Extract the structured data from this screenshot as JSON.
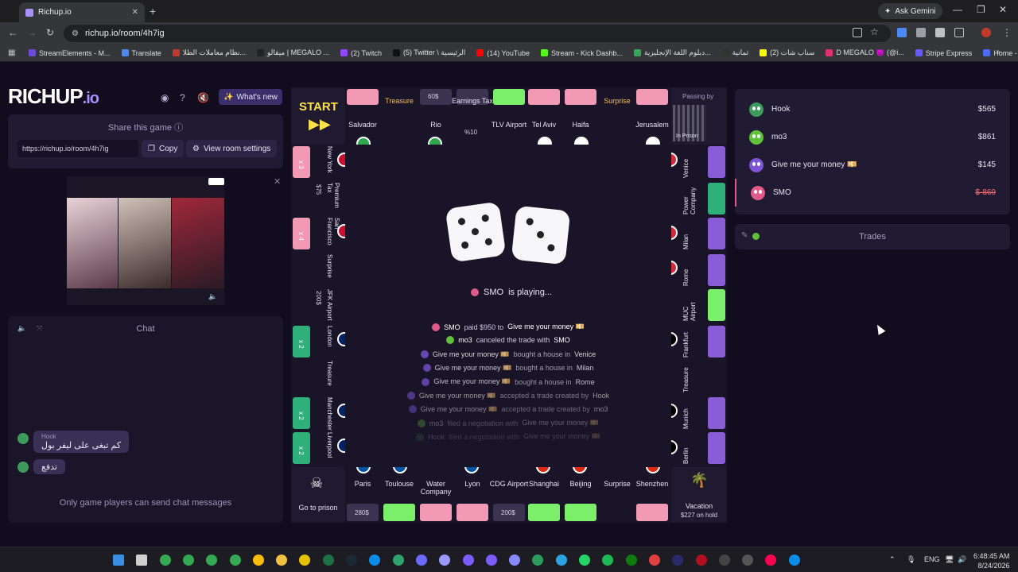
{
  "browser": {
    "tab_title": "Richup.io",
    "ask_gemini": "Ask Gemini",
    "url": "richup.io/room/4h7ig",
    "bookmarks": [
      {
        "label": "StreamElements - M...",
        "color": "#6b4bd8"
      },
      {
        "label": "Translate",
        "color": "#4a8af4"
      },
      {
        "label": "نظام معاملات الطلا...",
        "color": "#c0392b"
      },
      {
        "label": "ميقالو | MEGALO ...",
        "color": "#222222"
      },
      {
        "label": "(2) Twitch",
        "color": "#9146ff"
      },
      {
        "label": "(5) Twitter \\ الرئيسية",
        "color": "#111111"
      },
      {
        "label": "(14) YouTube",
        "color": "#ff0000"
      },
      {
        "label": "Stream - Kick Dashb...",
        "color": "#53fc18"
      },
      {
        "label": "دبلوم اللغة الإنجليزية...",
        "color": "#34a853"
      },
      {
        "label": "ثمانية",
        "color": "#333333"
      },
      {
        "label": "(2) سناب شات",
        "color": "#fffc00"
      },
      {
        "label": "D MEGALO 😈 (@i...",
        "color": "#e1306c"
      },
      {
        "label": "Stripe Express",
        "color": "#635bff"
      },
      {
        "label": "Home - Restream",
        "color": "#4a6cf7"
      }
    ]
  },
  "app": {
    "logo_main": "RICHUP",
    "logo_suffix": ".io",
    "whats_new": "What's new",
    "share": {
      "title": "Share this game",
      "url": "https://richup.io/room/4h7ig",
      "copy": "Copy",
      "settings": "View room settings"
    },
    "chat": {
      "title": "Chat",
      "messages": [
        {
          "author": "Hook",
          "text": "كم تبغى على ليفر بول"
        },
        {
          "author": "",
          "text": "تدفع"
        }
      ],
      "note": "Only game players can send chat messages"
    }
  },
  "board": {
    "corners": {
      "start": "START",
      "in_prison": "In Prison",
      "passing_by": "Passing by",
      "go_to_prison": "Go to prison",
      "vacation": "Vacation",
      "vacation_amount": "$227 on hold"
    },
    "top": [
      {
        "name": "Salvador",
        "strip": "#f29ab5"
      },
      {
        "name": "Treasure",
        "strip": ""
      },
      {
        "name": "Rio",
        "price": "60$"
      },
      {
        "name": "Earnings Tax",
        "sub": "%10"
      },
      {
        "name": "TLV Airport",
        "strip": "#7bef6a"
      },
      {
        "name": "Tel Aviv",
        "strip": "#f29ab5"
      },
      {
        "name": "Haifa",
        "strip": "#f29ab5"
      },
      {
        "name": "Surprise",
        "strip": ""
      },
      {
        "name": "Jerusalem",
        "strip": "#f29ab5"
      }
    ],
    "left": [
      {
        "name": "New York",
        "mult": "x 3"
      },
      {
        "name": "Premium Tax",
        "price": "$75"
      },
      {
        "name": "San Francisco",
        "mult": "x 4"
      },
      {
        "name": "Surprise"
      },
      {
        "name": "JFK Airport",
        "price": "200$"
      },
      {
        "name": "London",
        "mult": "x 2"
      },
      {
        "name": "Treasure"
      },
      {
        "name": "Manchester",
        "mult": "x 2"
      },
      {
        "name": "Liverpool",
        "mult": "x 2"
      }
    ],
    "right": [
      {
        "name": "Venice"
      },
      {
        "name": "Power Company"
      },
      {
        "name": "Milan"
      },
      {
        "name": "Rome"
      },
      {
        "name": "MUC Airport"
      },
      {
        "name": "Frankfurt"
      },
      {
        "name": "Treasure"
      },
      {
        "name": "Munich"
      },
      {
        "name": "Berlin"
      }
    ],
    "bottom": [
      {
        "name": "Paris",
        "price": "280$"
      },
      {
        "name": "Toulouse"
      },
      {
        "name": "Water Company"
      },
      {
        "name": "Lyon"
      },
      {
        "name": "CDG Airport",
        "price": "200$"
      },
      {
        "name": "Shanghai"
      },
      {
        "name": "Beijing"
      },
      {
        "name": "Surprise"
      },
      {
        "name": "Shenzhen"
      }
    ],
    "dice": [
      5,
      3
    ],
    "playing_name": "SMO",
    "playing_suffix": "is playing...",
    "log": [
      {
        "a": "SMO",
        "verb": "paid $950 to",
        "b": "Give me your money 💴",
        "opacity": "1"
      },
      {
        "a": "mo3",
        "verb": "canceled the trade with",
        "b": "SMO",
        "opacity": "1"
      },
      {
        "a": "Give me your money 💴",
        "verb": "bought a house in",
        "b": "Venice",
        "opacity": "0.8"
      },
      {
        "a": "Give me your money 💴",
        "verb": "bought a house in",
        "b": "Milan",
        "opacity": "0.75"
      },
      {
        "a": "Give me your money 💴",
        "verb": "bought a house in",
        "b": "Rome",
        "opacity": "0.7"
      },
      {
        "a": "Give me your money 💴",
        "verb": "accepted a trade created by",
        "b": "Hook",
        "opacity": "0.55"
      },
      {
        "a": "Give me your money 💴",
        "verb": "accepted a trade created by",
        "b": "mo3",
        "opacity": "0.45"
      },
      {
        "a": "mo3",
        "verb": "filed a negotiation with",
        "b": "Give me your money 💴",
        "opacity": "0.3"
      },
      {
        "a": "Hook",
        "verb": "filed a negotiation with",
        "b": "Give me your money 💴",
        "opacity": "0.18"
      }
    ]
  },
  "players": [
    {
      "name": "Hook",
      "money": "$565",
      "color": "#3e9a5b"
    },
    {
      "name": "mo3",
      "money": "$861",
      "color": "#5fc23a"
    },
    {
      "name": "Give me your money 💴",
      "money": "$145",
      "color": "#7b55d6"
    },
    {
      "name": "SMO",
      "money": "$-869",
      "color": "#e05b8a"
    }
  ],
  "trades_title": "Trades",
  "system": {
    "lang": "ENG",
    "time": "6:48:45 AM",
    "date": "8/24/2026"
  }
}
